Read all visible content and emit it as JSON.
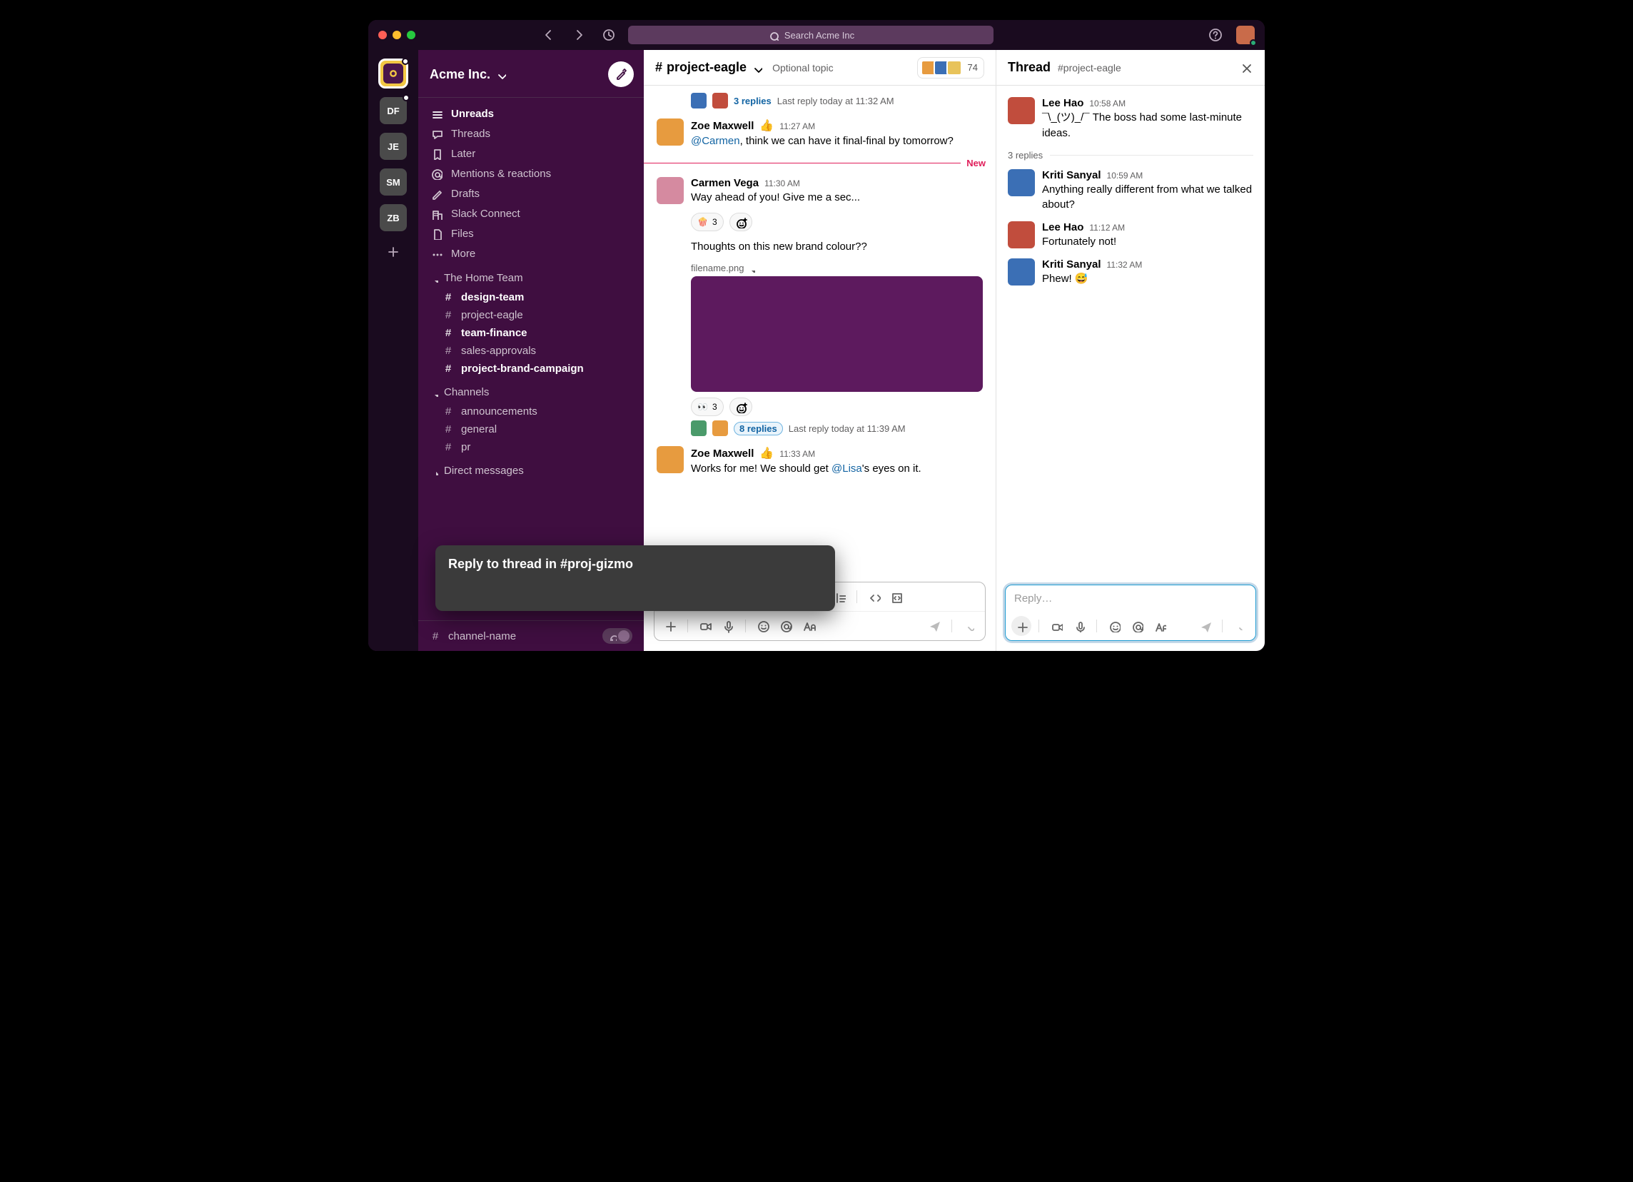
{
  "search": {
    "placeholder": "Search Acme Inc"
  },
  "rail": {
    "workspaces": [
      {
        "initials": "",
        "active": true,
        "badge": true
      },
      {
        "initials": "DF",
        "badge": true
      },
      {
        "initials": "JE"
      },
      {
        "initials": "SM"
      },
      {
        "initials": "ZB"
      }
    ]
  },
  "sidebar": {
    "workspace_name": "Acme Inc.",
    "nav": {
      "unreads": "Unreads",
      "threads": "Threads",
      "later": "Later",
      "mentions": "Mentions & reactions",
      "drafts": "Drafts",
      "slack_connect": "Slack Connect",
      "files": "Files",
      "more": "More"
    },
    "sections": [
      {
        "title": "The Home Team",
        "channels": [
          {
            "name": "design-team",
            "bold": true
          },
          {
            "name": "project-eagle",
            "bold": false
          },
          {
            "name": "team-finance",
            "bold": true
          },
          {
            "name": "sales-approvals",
            "bold": false
          },
          {
            "name": "project-brand-campaign",
            "bold": true
          }
        ]
      },
      {
        "title": "Channels",
        "channels": [
          {
            "name": "announcements",
            "bold": false
          },
          {
            "name": "general",
            "bold": false
          },
          {
            "name": "pr",
            "bold": false
          }
        ]
      }
    ],
    "dm_header": "Direct messages",
    "footer_channel": "channel-name"
  },
  "popover": {
    "text": "Reply to thread in #proj-gizmo"
  },
  "channel": {
    "name": "project-eagle",
    "topic_placeholder": "Optional topic",
    "member_count": "74",
    "divider_label": "New",
    "reply_strip_1": {
      "count": "3 replies",
      "meta": "Last reply today at 11:32 AM"
    },
    "messages": [
      {
        "author": "Zoe Maxwell",
        "time": "11:27 AM",
        "status_emoji": "👍",
        "body_before": "",
        "mention": "@Carmen",
        "body_after": ", think we can have it final-final by tomorrow?"
      },
      {
        "author": "Carmen Vega",
        "time": "11:30 AM",
        "body": "Way ahead of you! Give me a sec...",
        "reactions": [
          {
            "emoji": "🍿",
            "count": "3"
          }
        ],
        "followup": {
          "body": "Thoughts on this new brand colour??",
          "attachment_name": "filename.png",
          "reactions": [
            {
              "emoji": "👀",
              "count": "3"
            }
          ],
          "replies": {
            "count": "8 replies",
            "meta": "Last reply today at 11:39 AM"
          }
        }
      },
      {
        "author": "Zoe Maxwell",
        "time": "11:33 AM",
        "status_emoji": "👍",
        "body_before": "Works for me! We should get ",
        "mention": "@Lisa",
        "body_after": "'s eyes on it."
      }
    ]
  },
  "thread": {
    "title": "Thread",
    "subtitle": "#project-eagle",
    "root": {
      "author": "Lee Hao",
      "time": "10:58 AM",
      "body": "¯\\_(ツ)_/¯ The boss had some last-minute ideas."
    },
    "reply_count": "3 replies",
    "replies": [
      {
        "author": "Kriti Sanyal",
        "time": "10:59 AM",
        "body": "Anything really different from what we talked about?"
      },
      {
        "author": "Lee Hao",
        "time": "11:12 AM",
        "body": "Fortunately not!"
      },
      {
        "author": "Kriti Sanyal",
        "time": "11:32 AM",
        "body": "Phew! 😅"
      }
    ],
    "composer_placeholder": "Reply…"
  }
}
